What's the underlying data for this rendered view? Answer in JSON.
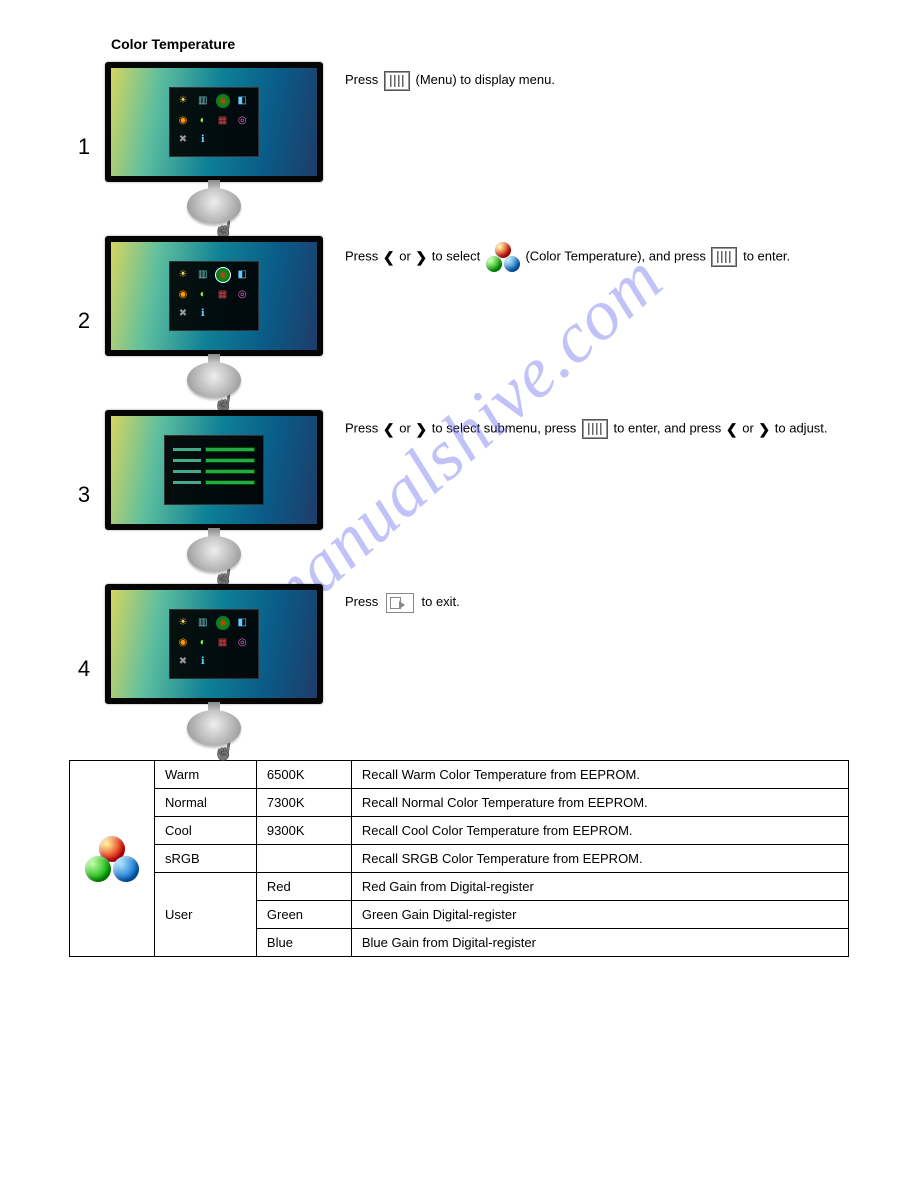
{
  "title": "Color Temperature",
  "watermark": "manualshive.com",
  "steps": {
    "s1": {
      "num": "1",
      "t1": "Press",
      "t2": "(Menu) to display menu."
    },
    "s2": {
      "num": "2",
      "t1": "Press",
      "t2": "or",
      "t3": "to select",
      "t4": "(Color Temperature), and press",
      "t5": "to enter."
    },
    "s3": {
      "num": "3",
      "t1": "Press",
      "t2": "or",
      "t3": "to select submenu, press",
      "t4": "to enter, and press",
      "t5": "or",
      "t6": "to adjust."
    },
    "s4": {
      "num": "4",
      "t1": "Press",
      "t2": "to exit."
    }
  },
  "table": {
    "rows": [
      {
        "name": "Warm",
        "value": "6500K",
        "desc": "Recall Warm Color Temperature from EEPROM."
      },
      {
        "name": "Normal",
        "value": "7300K",
        "desc": "Recall Normal Color Temperature from EEPROM."
      },
      {
        "name": "Cool",
        "value": "9300K",
        "desc": "Recall Cool Color Temperature from EEPROM."
      },
      {
        "name": "sRGB",
        "value": "",
        "desc": "Recall SRGB Color Temperature from EEPROM."
      }
    ],
    "user": {
      "name": "User",
      "sub": [
        {
          "value": "Red",
          "desc": "Red Gain from Digital-register"
        },
        {
          "value": "Green",
          "desc": "Green Gain Digital-register"
        },
        {
          "value": "Blue",
          "desc": "Blue Gain from Digital-register"
        }
      ]
    }
  }
}
